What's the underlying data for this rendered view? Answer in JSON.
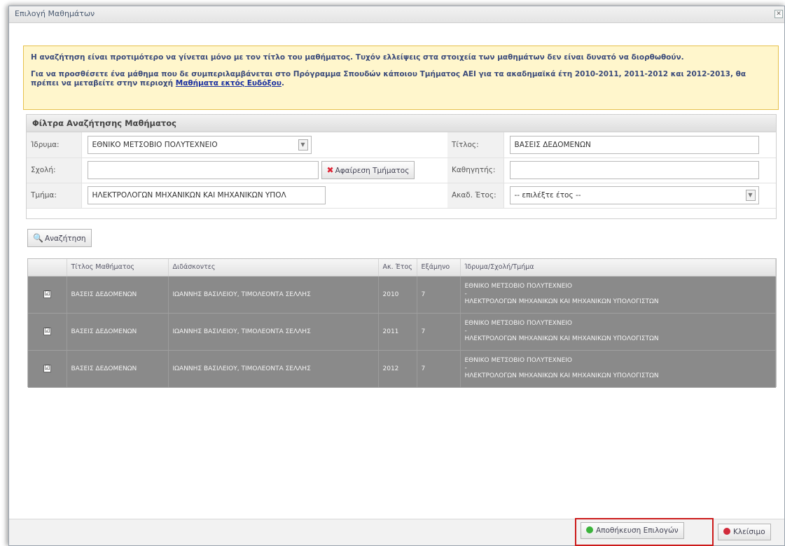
{
  "dialog": {
    "title": "Επιλογή Μαθημάτων",
    "close_glyph": "✕"
  },
  "notice": {
    "line1": "Η αναζήτηση είναι προτιμότερο να γίνεται μόνο με τον τίτλο του μαθήματος. Τυχόν ελλείψεις στα στοιχεία των μαθημάτων δεν είναι δυνατό να διορθωθούν.",
    "line2_prefix": "Για να προσθέσετε ένα μάθημα που δε συμπεριλαμβάνεται στο Πρόγραμμα Σπουδών κάποιου Τμήματος ΑΕΙ για τα ακαδημαϊκά έτη 2010-2011, 2011-2012 και 2012-2013, θα πρέπει να μεταβείτε στην περιοχή",
    "link": "Μαθήματα εκτός Ευδόξου",
    "line2_suffix": "."
  },
  "filters": {
    "header": "Φίλτρα Αναζήτησης Μαθήματος",
    "institution_label": "Ίδρυμα:",
    "institution_value": "ΕΘΝΙΚΟ ΜΕΤΣΟΒΙΟ ΠΟΛΥΤΕΧΝΕΙΟ",
    "school_label": "Σχολή:",
    "school_value": "",
    "remove_dept_button": "Αφαίρεση Τμήματος",
    "department_label": "Τμήμα:",
    "department_value": "ΗΛΕΚΤΡΟΛΟΓΩΝ ΜΗΧΑΝΙΚΩΝ ΚΑΙ ΜΗΧΑΝΙΚΩΝ ΥΠΟΛ",
    "title_label": "Τίτλος:",
    "title_value": "ΒΑΣΕΙΣ ΔΕΔΟΜΕΝΩΝ",
    "professor_label": "Καθηγητής:",
    "professor_value": "",
    "year_label": "Ακαδ. Έτος:",
    "year_value": "-- επιλέξτε έτος --"
  },
  "search_button": "Αναζήτηση",
  "results": {
    "columns": [
      "",
      "Τίτλος Μαθήματος",
      "Διδάσκοντες",
      "Ακ. Έτος",
      "Εξάμηνο",
      "Ίδρυμα/Σχολή/Τμήμα"
    ],
    "rows": [
      {
        "checked": "☑",
        "title": "ΒΑΣΕΙΣ ΔΕΔΟΜΕΝΩΝ",
        "teachers": "ΙΩΑΝΝΗΣ ΒΑΣΙΛΕΙΟΥ, ΤΙΜΟΛΕΟΝΤΑ ΣΕΛΛΗΣ",
        "year": "2010",
        "semester": "7",
        "inst1": "ΕΘΝΙΚΟ ΜΕΤΣΟΒΙΟ ΠΟΛΥΤΕΧΝΕΙΟ",
        "inst2": "-",
        "inst3": "ΗΛΕΚΤΡΟΛΟΓΩΝ ΜΗΧΑΝΙΚΩΝ ΚΑΙ ΜΗΧΑΝΙΚΩΝ ΥΠΟΛΟΓΙΣΤΩΝ"
      },
      {
        "checked": "☑",
        "title": "ΒΑΣΕΙΣ ΔΕΔΟΜΕΝΩΝ",
        "teachers": "ΙΩΑΝΝΗΣ ΒΑΣΙΛΕΙΟΥ, ΤΙΜΟΛΕΟΝΤΑ ΣΕΛΛΗΣ",
        "year": "2011",
        "semester": "7",
        "inst1": "ΕΘΝΙΚΟ ΜΕΤΣΟΒΙΟ ΠΟΛΥΤΕΧΝΕΙΟ",
        "inst2": "-",
        "inst3": "ΗΛΕΚΤΡΟΛΟΓΩΝ ΜΗΧΑΝΙΚΩΝ ΚΑΙ ΜΗΧΑΝΙΚΩΝ ΥΠΟΛΟΓΙΣΤΩΝ"
      },
      {
        "checked": "☑",
        "title": "ΒΑΣΕΙΣ ΔΕΔΟΜΕΝΩΝ",
        "teachers": "ΙΩΑΝΝΗΣ ΒΑΣΙΛΕΙΟΥ, ΤΙΜΟΛΕΟΝΤΑ ΣΕΛΛΗΣ",
        "year": "2012",
        "semester": "7",
        "inst1": "ΕΘΝΙΚΟ ΜΕΤΣΟΒΙΟ ΠΟΛΥΤΕΧΝΕΙΟ",
        "inst2": "-",
        "inst3": "ΗΛΕΚΤΡΟΛΟΓΩΝ ΜΗΧΑΝΙΚΩΝ ΚΑΙ ΜΗΧΑΝΙΚΩΝ ΥΠΟΛΟΓΙΣΤΩΝ"
      }
    ]
  },
  "footer": {
    "save_button": "Αποθήκευση Επιλογών",
    "close_button": "Κλείσιμο"
  },
  "icons": {
    "search": "search-icon",
    "remove": "close-icon",
    "save": "save-icon",
    "close": "cancel-icon"
  }
}
